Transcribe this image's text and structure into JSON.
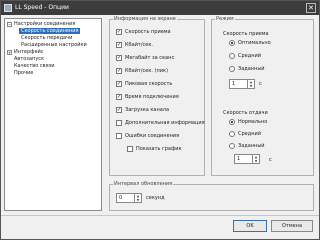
{
  "window": {
    "title": "LL Speed - Опции",
    "close_glyph": "✕"
  },
  "tree": [
    {
      "label": "Настройки соединения",
      "expander": "−"
    },
    {
      "label": "Скорость соединения",
      "selected": true
    },
    {
      "label": "Скорость передачи"
    },
    {
      "label": "Расширенные настройки"
    },
    {
      "label": "Интерфейс",
      "expander": "+"
    },
    {
      "label": "Автозапуск"
    },
    {
      "label": "Качество связи"
    },
    {
      "label": "Прочие"
    }
  ],
  "main_group": {
    "legend": "Информация на экране",
    "checks": [
      {
        "label": "Скорость приема",
        "checked": true
      },
      {
        "label": "Кбайт/сек.",
        "checked": true
      },
      {
        "label": "Мегабайт за сеанс",
        "checked": true
      },
      {
        "label": "Кбайт/сек. (пик)",
        "checked": true
      },
      {
        "label": "Пиковая скорость",
        "checked": true
      },
      {
        "label": "Время подключения",
        "checked": true
      },
      {
        "label": "Загрузка канала",
        "checked": true
      },
      {
        "label": "Дополнительная информация",
        "checked": false
      },
      {
        "label": "Ошибки соединения",
        "checked": false
      }
    ],
    "sub_check": {
      "label": "Показать график",
      "checked": false
    }
  },
  "right_group": {
    "legend": "Режим",
    "receive": {
      "label": "Скорость приема",
      "options": [
        {
          "label": "Оптимально",
          "on": true
        },
        {
          "label": "Средний",
          "on": false
        },
        {
          "label": "Заданный",
          "on": false
        }
      ],
      "value": "1",
      "unit": "с"
    },
    "send": {
      "label": "Скорость отдачи",
      "options": [
        {
          "label": "Нормально",
          "on": true
        },
        {
          "label": "Средний",
          "on": false
        },
        {
          "label": "Заданный",
          "on": false
        }
      ],
      "value": "1",
      "unit": "с"
    }
  },
  "bottom_group": {
    "legend": "Интервал обновления",
    "value": "0",
    "unit": "секунд"
  },
  "buttons": {
    "ok": "OK",
    "cancel": "Отмена"
  }
}
